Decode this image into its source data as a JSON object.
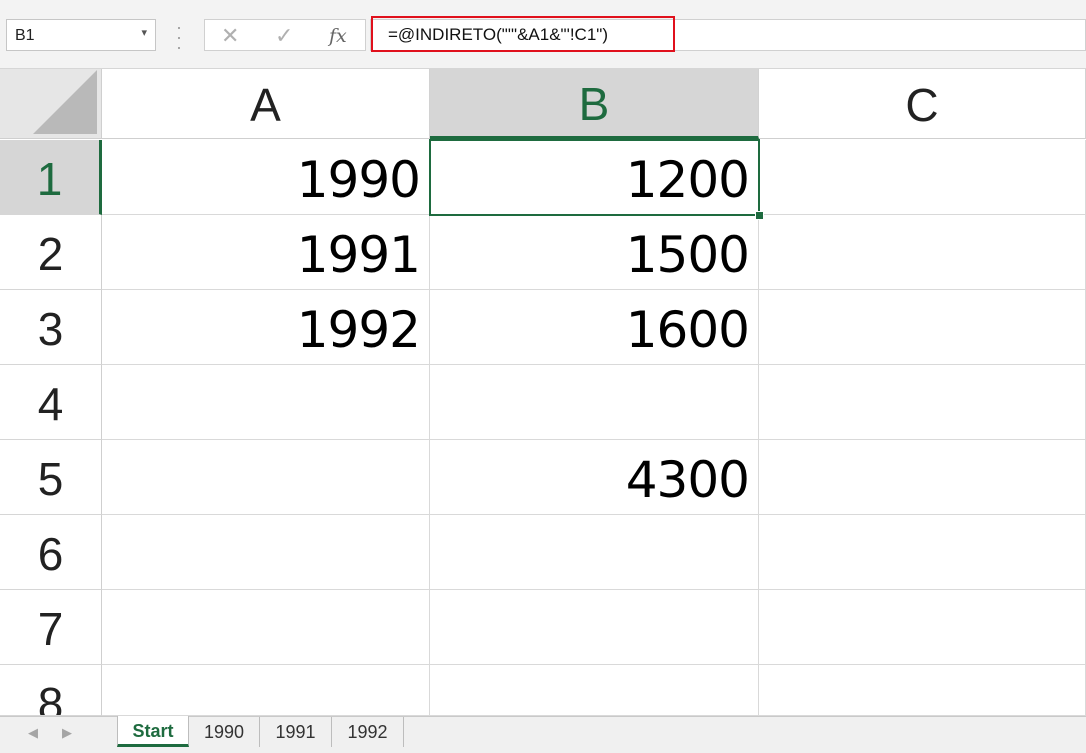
{
  "name_box": {
    "value": "B1"
  },
  "formula_bar": {
    "cancel_glyph": "✕",
    "enter_glyph": "✓",
    "fx_label": "fx",
    "formula": "=@INDIRETO(\"'\"&A1&\"'!C1\")",
    "highlight_color": "#e0101c"
  },
  "columns": [
    "A",
    "B",
    "C"
  ],
  "selected_column": "B",
  "rows": [
    "1",
    "2",
    "3",
    "4",
    "5",
    "6",
    "7",
    "8"
  ],
  "selected_row": "1",
  "cells": {
    "A1": "1990",
    "B1": "1200",
    "A2": "1991",
    "B2": "1500",
    "A3": "1992",
    "B3": "1600",
    "B5": "4300"
  },
  "sheet_tabs": [
    {
      "label": "Start",
      "active": true
    },
    {
      "label": "1990",
      "active": false
    },
    {
      "label": "1991",
      "active": false
    },
    {
      "label": "1992",
      "active": false
    }
  ],
  "colors": {
    "accent": "#1e6b3f",
    "header_selected_bg": "#d6d6d6"
  }
}
